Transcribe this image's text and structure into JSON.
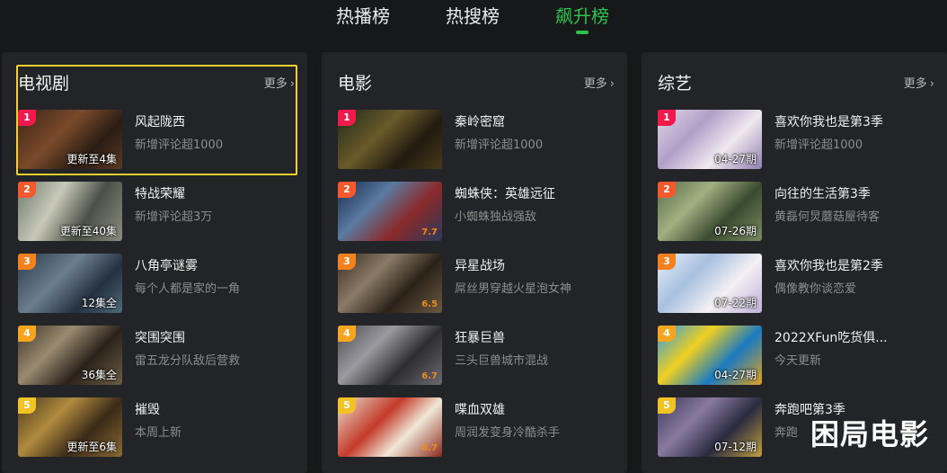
{
  "tabs": [
    {
      "label": "热播榜",
      "active": false
    },
    {
      "label": "热搜榜",
      "active": false
    },
    {
      "label": "飙升榜",
      "active": true
    }
  ],
  "accent_color": "#2ec14d",
  "rank_colors": {
    "1": "#f2194c",
    "2": "#f5582c",
    "3": "#f5801e",
    "4": "#f7a51e",
    "5": "#f2c324"
  },
  "panels": [
    {
      "title": "电视剧",
      "more_label": "更多",
      "items": [
        {
          "rank": "1",
          "title": "风起陇西",
          "subtitle": "新增评论超1000",
          "badge": "更新至4集"
        },
        {
          "rank": "2",
          "title": "特战荣耀",
          "subtitle": "新增评论超3万",
          "badge": "更新至40集"
        },
        {
          "rank": "3",
          "title": "八角亭谜雾",
          "subtitle": "每个人都是家的一角",
          "badge": "12集全"
        },
        {
          "rank": "4",
          "title": "突围突围",
          "subtitle": "雷五龙分队敌后营救",
          "badge": "36集全"
        },
        {
          "rank": "5",
          "title": "摧毁",
          "subtitle": "本周上新",
          "badge": "更新至6集"
        }
      ]
    },
    {
      "title": "电影",
      "more_label": "更多",
      "items": [
        {
          "rank": "1",
          "title": "秦岭密窟",
          "subtitle": "新增评论超1000",
          "badge": ""
        },
        {
          "rank": "2",
          "title": "蜘蛛侠：英雄远征",
          "subtitle": "小蜘蛛独战强敌",
          "badge": "7.7"
        },
        {
          "rank": "3",
          "title": "异星战场",
          "subtitle": "屌丝男穿越火星泡女神",
          "badge": "6.5"
        },
        {
          "rank": "4",
          "title": "狂暴巨兽",
          "subtitle": "三头巨兽城市混战",
          "badge": "6.7"
        },
        {
          "rank": "5",
          "title": "喋血双雄",
          "subtitle": "周润发变身冷酷杀手",
          "badge": "8.7"
        }
      ]
    },
    {
      "title": "综艺",
      "more_label": "更多",
      "items": [
        {
          "rank": "1",
          "title": "喜欢你我也是第3季",
          "subtitle": "新增评论超1000",
          "badge": "04-27期"
        },
        {
          "rank": "2",
          "title": "向往的生活第3季",
          "subtitle": "黄磊何炅蘑菇屋待客",
          "badge": "07-26期"
        },
        {
          "rank": "3",
          "title": "喜欢你我也是第2季",
          "subtitle": "偶像教你谈恋爱",
          "badge": "07-22期"
        },
        {
          "rank": "4",
          "title": "2022XFun吃货俱...",
          "subtitle": "今天更新",
          "badge": "04-27期"
        },
        {
          "rank": "5",
          "title": "奔跑吧第3季",
          "subtitle": "奔跑",
          "badge": "07-12期"
        }
      ]
    }
  ],
  "watermark": "困局电影"
}
